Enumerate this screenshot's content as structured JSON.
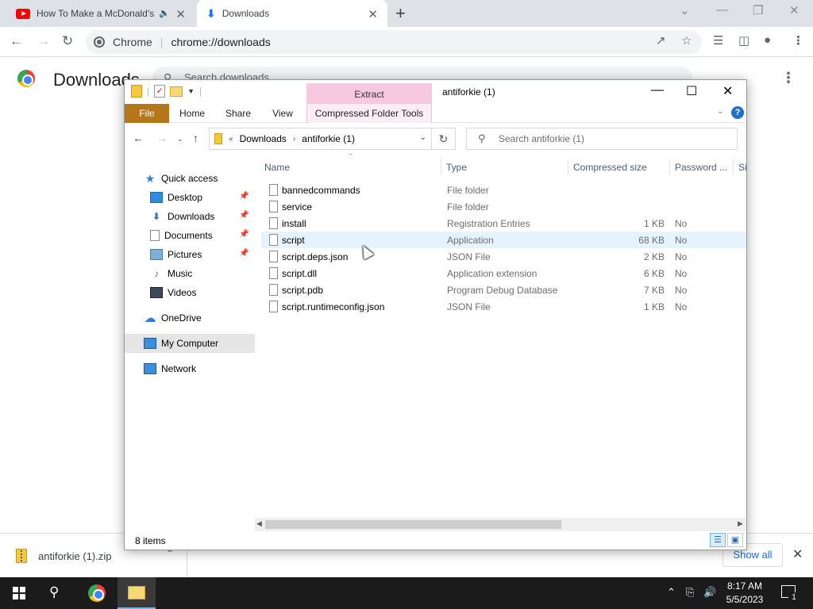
{
  "browser": {
    "tabs": [
      {
        "title": "How To Make a McDonald's",
        "icon": "youtube-icon"
      },
      {
        "title": "Downloads",
        "icon": "download-icon"
      }
    ],
    "omnibox": {
      "site": "Chrome",
      "url": "chrome://downloads"
    }
  },
  "downloads_page": {
    "title": "Downloads",
    "search_placeholder": "Search downloads"
  },
  "shelf": {
    "file": "antiforkie (1).zip",
    "show_all": "Show all"
  },
  "explorer": {
    "window_title": "antiforkie (1)",
    "context_tab": "Extract",
    "ribbon_tabs": [
      "File",
      "Home",
      "Share",
      "View",
      "Compressed Folder Tools"
    ],
    "breadcrumb": [
      "Downloads",
      "antiforkie (1)"
    ],
    "search_placeholder": "Search antiforkie (1)",
    "nav": [
      {
        "label": "Quick access",
        "icon": "star-icon",
        "pinned": false
      },
      {
        "label": "Desktop",
        "icon": "desktop-icon",
        "pinned": true
      },
      {
        "label": "Downloads",
        "icon": "download-arrow-icon",
        "pinned": true
      },
      {
        "label": "Documents",
        "icon": "documents-icon",
        "pinned": true
      },
      {
        "label": "Pictures",
        "icon": "pictures-icon",
        "pinned": true
      },
      {
        "label": "Music",
        "icon": "music-icon",
        "pinned": false
      },
      {
        "label": "Videos",
        "icon": "videos-icon",
        "pinned": false
      },
      {
        "label": "OneDrive",
        "icon": "cloud-icon",
        "pinned": false
      },
      {
        "label": "My Computer",
        "icon": "computer-icon",
        "pinned": false
      },
      {
        "label": "Network",
        "icon": "network-icon",
        "pinned": false
      }
    ],
    "columns": [
      "Name",
      "Type",
      "Compressed size",
      "Password ...",
      "Si"
    ],
    "files": [
      {
        "name": "bannedcommands",
        "type": "File folder",
        "size": "",
        "password": ""
      },
      {
        "name": "service",
        "type": "File folder",
        "size": "",
        "password": ""
      },
      {
        "name": "install",
        "type": "Registration Entries",
        "size": "1 KB",
        "password": "No"
      },
      {
        "name": "script",
        "type": "Application",
        "size": "68 KB",
        "password": "No"
      },
      {
        "name": "script.deps.json",
        "type": "JSON File",
        "size": "2 KB",
        "password": "No"
      },
      {
        "name": "script.dll",
        "type": "Application extension",
        "size": "6 KB",
        "password": "No"
      },
      {
        "name": "script.pdb",
        "type": "Program Debug Database",
        "size": "7 KB",
        "password": "No"
      },
      {
        "name": "script.runtimeconfig.json",
        "type": "JSON File",
        "size": "1 KB",
        "password": "No"
      }
    ],
    "status": "8 items"
  },
  "taskbar": {
    "time": "8:17 AM",
    "date": "5/5/2023",
    "notification_count": "1"
  }
}
